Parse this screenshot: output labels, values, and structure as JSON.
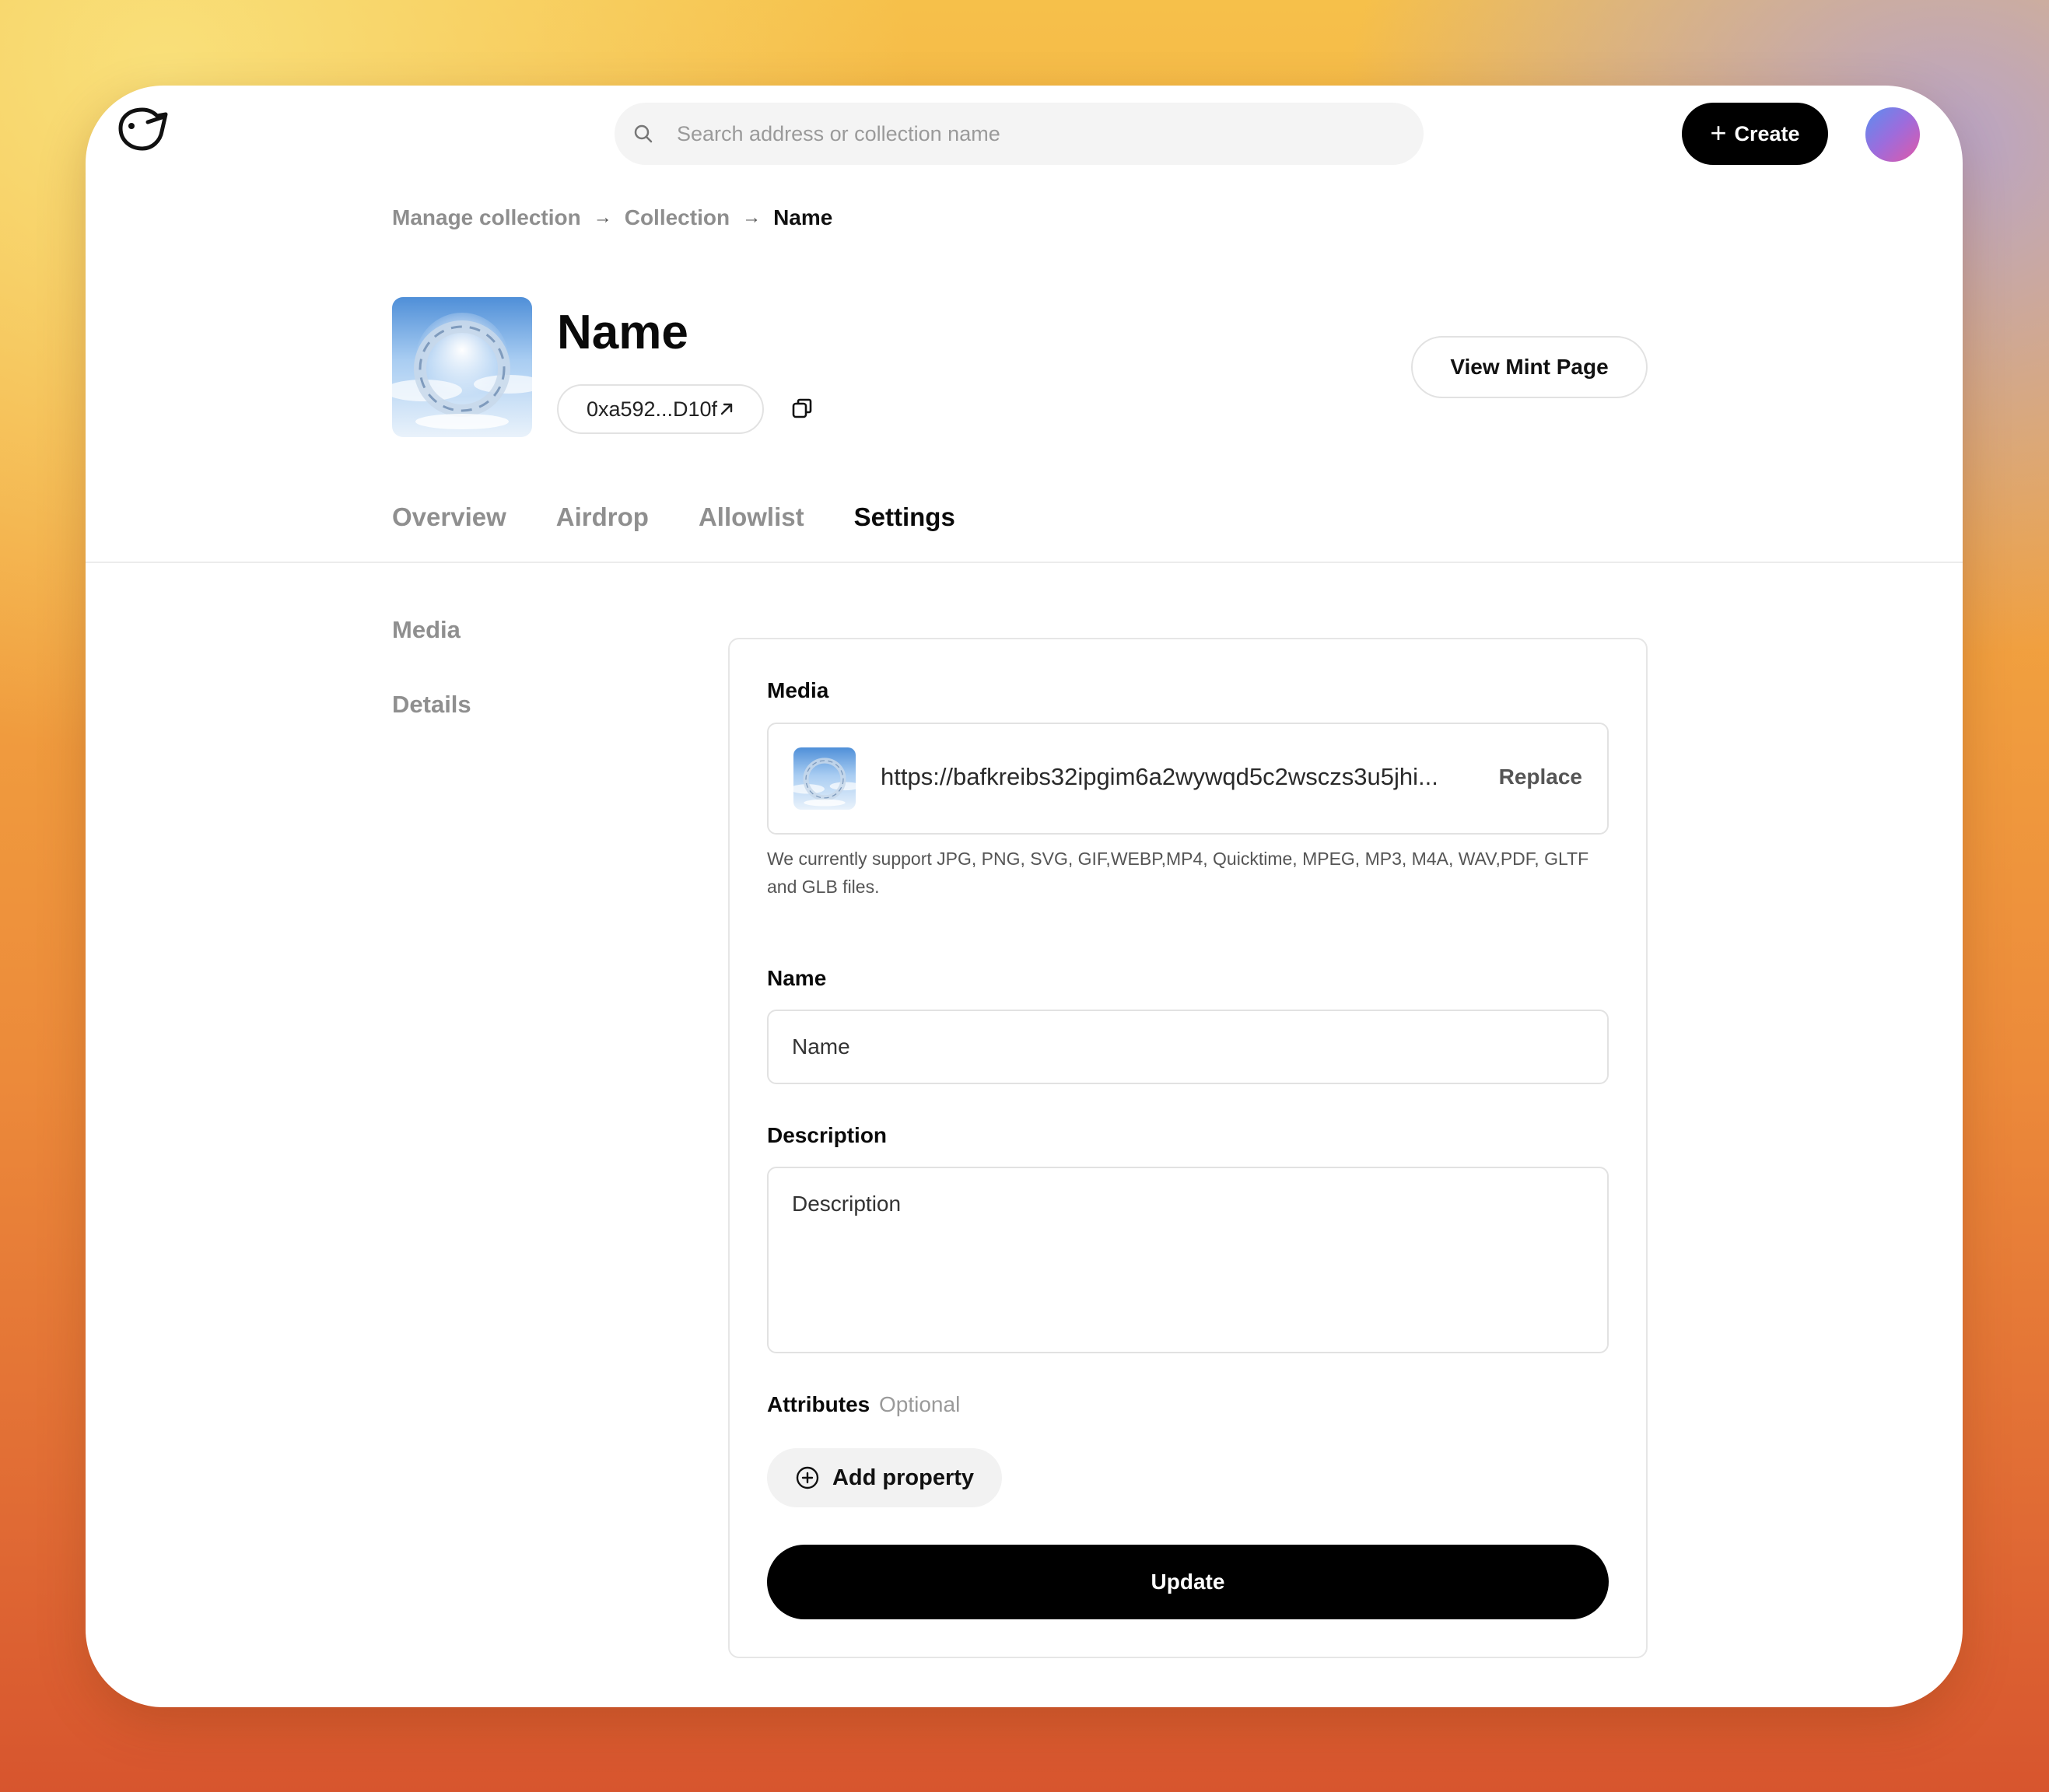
{
  "header": {
    "search_placeholder": "Search address or collection name",
    "create_label": "Create"
  },
  "breadcrumb": [
    {
      "label": "Manage collection"
    },
    {
      "label": "Collection"
    },
    {
      "label": "Name"
    }
  ],
  "collection": {
    "name": "Name",
    "address": "0xa592...D10f",
    "view_mint_label": "View Mint Page"
  },
  "tabs": [
    {
      "label": "Overview",
      "active": false
    },
    {
      "label": "Airdrop",
      "active": false
    },
    {
      "label": "Allowlist",
      "active": false
    },
    {
      "label": "Settings",
      "active": true
    }
  ],
  "side_menu": [
    {
      "label": "Media"
    },
    {
      "label": "Details"
    }
  ],
  "form": {
    "media_label": "Media",
    "media_url": "https://bafkreibs32ipgim6a2wywqd5c2wsczs3u5jhi...",
    "replace_label": "Replace",
    "media_help": "We currently support JPG, PNG, SVG, GIF,WEBP,MP4, Quicktime, MPEG, MP3, M4A, WAV,PDF, GLTF and GLB files.",
    "name_label": "Name",
    "name_placeholder": "Name",
    "description_label": "Description",
    "description_placeholder": "Description",
    "attributes_label": "Attributes",
    "attributes_optional": "Optional",
    "add_property_label": "Add property",
    "update_label": "Update"
  },
  "colors": {
    "primary_button": "#000000",
    "muted_text": "#8f8f8f",
    "border": "#e2e2e2"
  }
}
